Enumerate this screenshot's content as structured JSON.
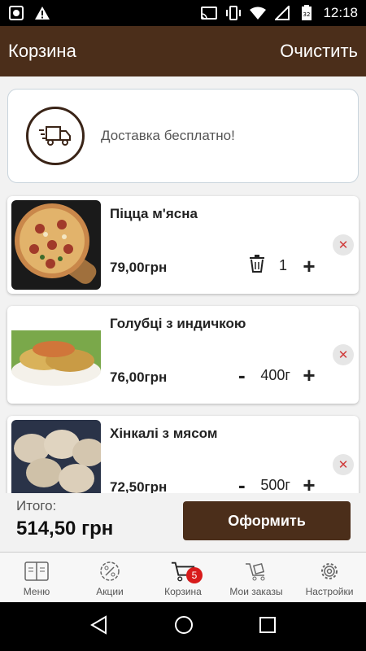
{
  "status_bar": {
    "time": "12:18",
    "left_icons": [
      "screenshot-icon",
      "warning-icon"
    ],
    "right_icons": [
      "cast-icon",
      "vibrate-icon",
      "wifi-icon",
      "signal-icon",
      "battery-icon"
    ],
    "battery_level": "32"
  },
  "app_bar": {
    "title": "Корзина",
    "clear_label": "Очистить"
  },
  "delivery": {
    "icon": "delivery-truck-icon",
    "text": "Доставка бесплатно!"
  },
  "cart_items": [
    {
      "name": "Піцца м'ясна",
      "price": "79,00грн",
      "quantity": "1",
      "image": "pizza-image",
      "has_delete": true
    },
    {
      "name": "Голубці з индичкою",
      "price": "76,00грн",
      "quantity": "400г",
      "image": "golubtsi-image",
      "has_delete": false
    },
    {
      "name": "Хінкалі з мясом",
      "price": "72,50грн",
      "quantity": "500г",
      "image": "khinkali-image",
      "has_delete": false
    }
  ],
  "total": {
    "label": "Итого:",
    "sum": "514,50 грн",
    "checkout_label": "Оформить"
  },
  "bottom_nav": {
    "items": [
      {
        "label": "Меню",
        "icon": "menu-book-icon"
      },
      {
        "label": "Акции",
        "icon": "discount-icon"
      },
      {
        "label": "Корзина",
        "icon": "cart-icon",
        "badge": "5",
        "active": true
      },
      {
        "label": "Мои заказы",
        "icon": "orders-icon"
      },
      {
        "label": "Настройки",
        "icon": "settings-icon"
      }
    ]
  },
  "colors": {
    "brand_brown": "#4b2e1a",
    "badge_red": "#d81b1b",
    "remove_red": "#d03a3a"
  }
}
